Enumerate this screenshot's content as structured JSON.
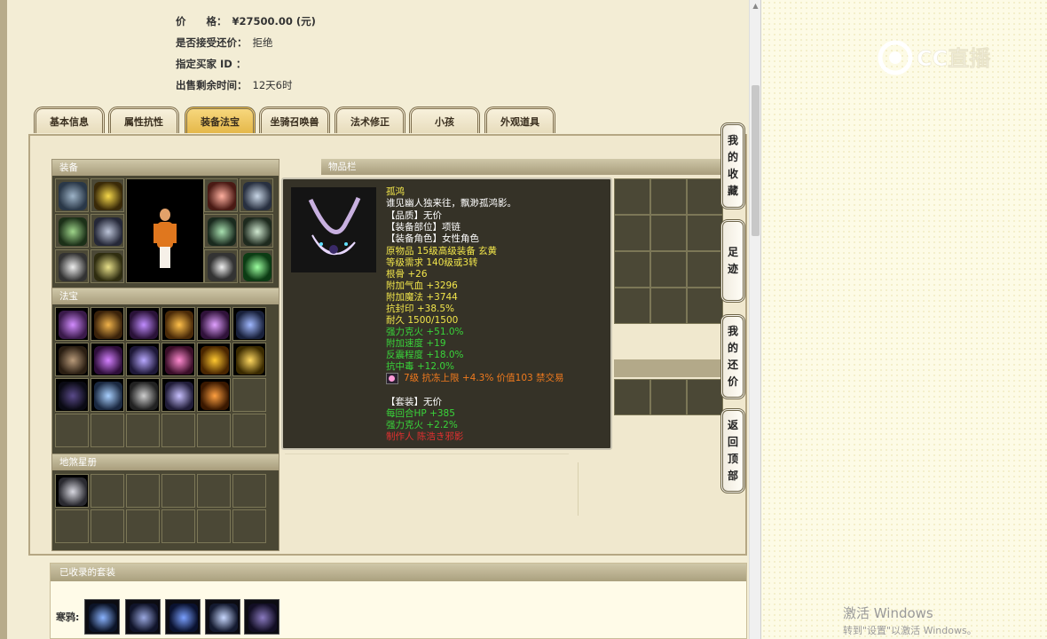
{
  "info": {
    "price_label": "价　　格：",
    "price_value": "¥27500.00 (元)",
    "counter_label": "是否接受还价：",
    "counter_value": "拒绝",
    "buyer_label": "指定买家 ID ：",
    "buyer_value": "",
    "time_label": "出售剩余时间：",
    "time_value": "12天6时"
  },
  "tabs": [
    "基本信息",
    "属性抗性",
    "装备法宝",
    "坐骑召唤兽",
    "法术修正",
    "小孩",
    "外观道具"
  ],
  "active_tab": "装备法宝",
  "panels": {
    "equipment": "装备",
    "treasure": "法宝",
    "starsign": "地煞星册",
    "inventory": "物品栏",
    "suits": "已收录的套装"
  },
  "tooltip": {
    "name": "孤鸿",
    "lines": [
      {
        "text": "谁见幽人独来往，飘渺孤鸿影。",
        "color": "#ffffff"
      },
      {
        "text": "【品质】无价",
        "color": "#ffffff"
      },
      {
        "text": "【装备部位】项链",
        "color": "#ffffff"
      },
      {
        "text": "【装备角色】女性角色",
        "color": "#ffffff"
      },
      {
        "text": "原物品 15级高级装备 玄黄",
        "color": "#f2e64b"
      },
      {
        "text": "等级需求 140级或3转",
        "color": "#f2e64b"
      },
      {
        "text": "根骨 +26",
        "color": "#f2e64b"
      },
      {
        "text": "附加气血 +3296",
        "color": "#f2e64b"
      },
      {
        "text": "附加魔法 +3744",
        "color": "#f2e64b"
      },
      {
        "text": "抗封印 +38.5%",
        "color": "#f2e64b"
      },
      {
        "text": "耐久 1500/1500",
        "color": "#f2e64b"
      },
      {
        "text": "强力克火 +51.0%",
        "color": "#39d43a"
      },
      {
        "text": "附加速度 +19",
        "color": "#39d43a"
      },
      {
        "text": "反震程度 +18.0%",
        "color": "#39d43a"
      },
      {
        "text": "抗中毒 +12.0%",
        "color": "#39d43a"
      },
      {
        "text": "7级 抗冻上限 +4.3% 价值103 禁交易",
        "color": "#f07a1e"
      },
      {
        "text": "",
        "color": "#ffffff"
      },
      {
        "text": "【套装】无价",
        "color": "#ffffff"
      },
      {
        "text": "每回合HP +385",
        "color": "#39d43a"
      },
      {
        "text": "强力克火 +2.2%",
        "color": "#39d43a"
      },
      {
        "text": "制作人 陈浩き邪影",
        "color": "#e03030"
      }
    ]
  },
  "side_buttons": [
    {
      "label": "我的收藏"
    },
    {
      "label": "足迹"
    },
    {
      "label": "我的还价"
    },
    {
      "label": "返回顶部"
    }
  ],
  "suit_label": "寒鸦:",
  "brand": "CC直播",
  "os_watermark": {
    "line1": "激活 Windows",
    "line2": "转到\"设置\"以激活 Windows。"
  },
  "icons": {
    "scroll_up": "triangle-up-icon",
    "logo": "cc-live-logo"
  }
}
